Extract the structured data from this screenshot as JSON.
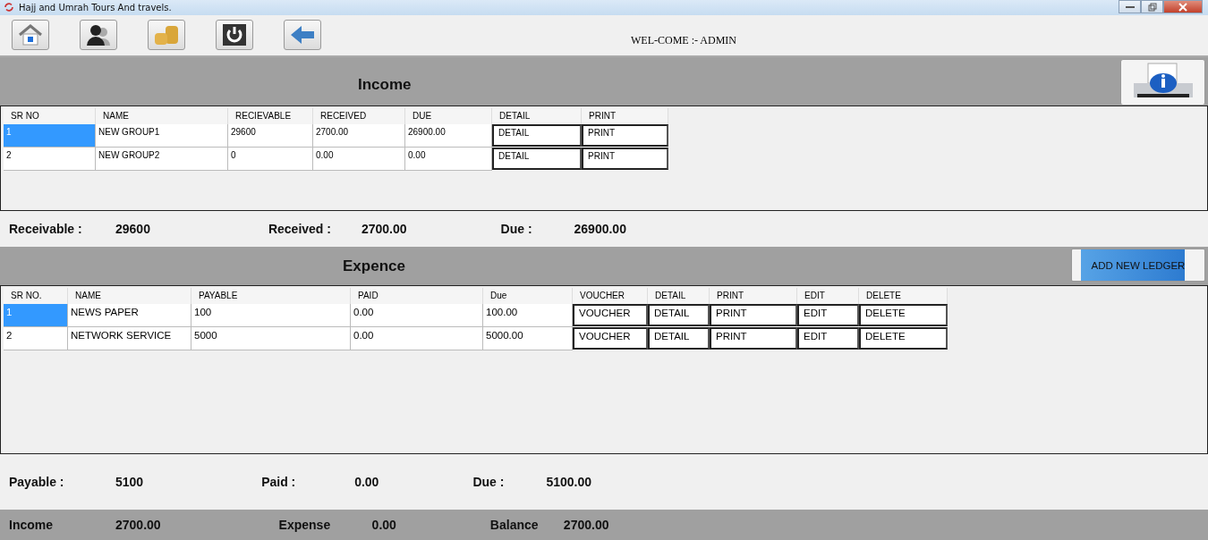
{
  "window": {
    "title": "Hajj and Umrah Tours And travels."
  },
  "toolbar": {
    "welcome": "WEL-COME :- ADMIN"
  },
  "income": {
    "title": "Income",
    "columns": [
      {
        "label": "SR NO",
        "kind": "text"
      },
      {
        "label": "NAME",
        "kind": "text"
      },
      {
        "label": "RECIEVABLE",
        "kind": "text"
      },
      {
        "label": "RECEIVED",
        "kind": "text"
      },
      {
        "label": "DUE",
        "kind": "text"
      },
      {
        "label": "DETAIL",
        "kind": "button"
      },
      {
        "label": "PRINT",
        "kind": "button"
      }
    ],
    "rows": [
      {
        "selected": true,
        "cells": [
          "1",
          "NEW GROUP1",
          "29600",
          "2700.00",
          "26900.00",
          "DETAIL",
          "PRINT"
        ]
      },
      {
        "selected": false,
        "cells": [
          "2",
          "NEW GROUP2",
          "0",
          "0.00",
          "0.00",
          "DETAIL",
          "PRINT"
        ]
      }
    ],
    "summary": [
      {
        "label": "Receivable :",
        "value": "29600"
      },
      {
        "label": "Received :",
        "value": "2700.00"
      },
      {
        "label": "Due :",
        "value": "26900.00"
      }
    ]
  },
  "expense": {
    "title": "Expence",
    "add_button": "ADD NEW LEDGER",
    "columns": [
      {
        "label": "SR NO.",
        "kind": "text"
      },
      {
        "label": "NAME",
        "kind": "text"
      },
      {
        "label": "PAYABLE",
        "kind": "text"
      },
      {
        "label": "PAID",
        "kind": "text"
      },
      {
        "label": "Due",
        "kind": "text"
      },
      {
        "label": "VOUCHER",
        "kind": "button"
      },
      {
        "label": "DETAIL",
        "kind": "button"
      },
      {
        "label": "PRINT",
        "kind": "button"
      },
      {
        "label": "EDIT",
        "kind": "button"
      },
      {
        "label": "DELETE",
        "kind": "button"
      }
    ],
    "rows": [
      {
        "selected": true,
        "cells": [
          "1",
          "NEWS PAPER",
          "100",
          "0.00",
          "100.00",
          "VOUCHER",
          "DETAIL",
          "PRINT",
          "EDIT",
          "DELETE"
        ]
      },
      {
        "selected": false,
        "cells": [
          "2",
          "NETWORK SERVICE",
          "5000",
          "0.00",
          "5000.00",
          "VOUCHER",
          "DETAIL",
          "PRINT",
          "EDIT",
          "DELETE"
        ]
      }
    ],
    "summary": [
      {
        "label": "Payable :",
        "value": "5100"
      },
      {
        "label": "Paid :",
        "value": "0.00"
      },
      {
        "label": "Due :",
        "value": "5100.00"
      }
    ]
  },
  "totals": [
    {
      "label": "Income",
      "value": "2700.00"
    },
    {
      "label": "Expense",
      "value": "0.00"
    },
    {
      "label": "Balance",
      "value": "2700.00"
    }
  ]
}
